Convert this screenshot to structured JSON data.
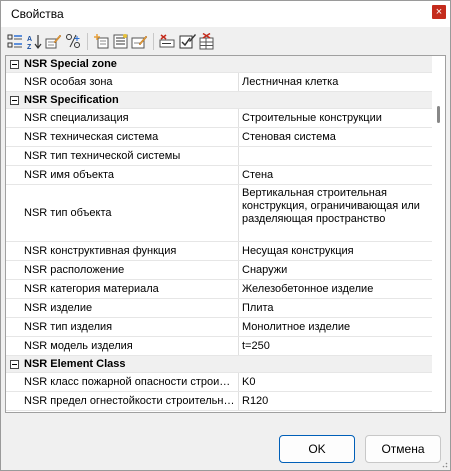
{
  "window": {
    "title": "Свойства",
    "close_label": "×"
  },
  "toolbar": {
    "buttons": [
      {
        "name": "categorized-view-icon"
      },
      {
        "name": "alphabetical-sort-icon"
      },
      {
        "name": "edit-properties-icon"
      },
      {
        "name": "calculate-icon"
      },
      {
        "name": "add-property-icon"
      },
      {
        "name": "property-list-icon"
      },
      {
        "name": "edit-value-icon"
      },
      {
        "name": "delete-property-icon"
      },
      {
        "name": "checklist-edit-icon"
      },
      {
        "name": "table-delete-icon"
      }
    ]
  },
  "grid": {
    "groups": [
      {
        "name": "NSR Special zone",
        "rows": [
          {
            "name": "NSR особая зона",
            "value": "Лестничная клетка"
          }
        ]
      },
      {
        "name": "NSR Specification",
        "rows": [
          {
            "name": "NSR специализация",
            "value": "Строительные конструкции"
          },
          {
            "name": "NSR техническая система",
            "value": "Стеновая система"
          },
          {
            "name": "NSR тип технической системы",
            "value": ""
          },
          {
            "name": "NSR имя объекта",
            "value": "Стена"
          },
          {
            "name": "NSR тип объекта",
            "value": "Вертикальная строительная конструкция, ограничивающая или разделяющая пространство"
          },
          {
            "name": "NSR конструктивная функция",
            "value": "Несущая конструкция"
          },
          {
            "name": "NSR расположение",
            "value": "Снаружи"
          },
          {
            "name": "NSR категория материала",
            "value": "Железобетонное изделие"
          },
          {
            "name": "NSR изделие",
            "value": "Плита"
          },
          {
            "name": "NSR тип изделия",
            "value": "Монолитное изделие"
          },
          {
            "name": "NSR модель изделия",
            "value": "t=250"
          }
        ]
      },
      {
        "name": "NSR Element Class",
        "rows": [
          {
            "name": "NSR класс пожарной опасности строител...",
            "value": "K0"
          },
          {
            "name": "NSR предел огнестойкости строительных ...",
            "value": "R120"
          }
        ]
      }
    ]
  },
  "buttons": {
    "ok": "OK",
    "cancel": "Отмена"
  },
  "colors": {
    "accent": "#005fb8",
    "close": "#c42b1c",
    "group_bg": "#f0f0f0"
  }
}
